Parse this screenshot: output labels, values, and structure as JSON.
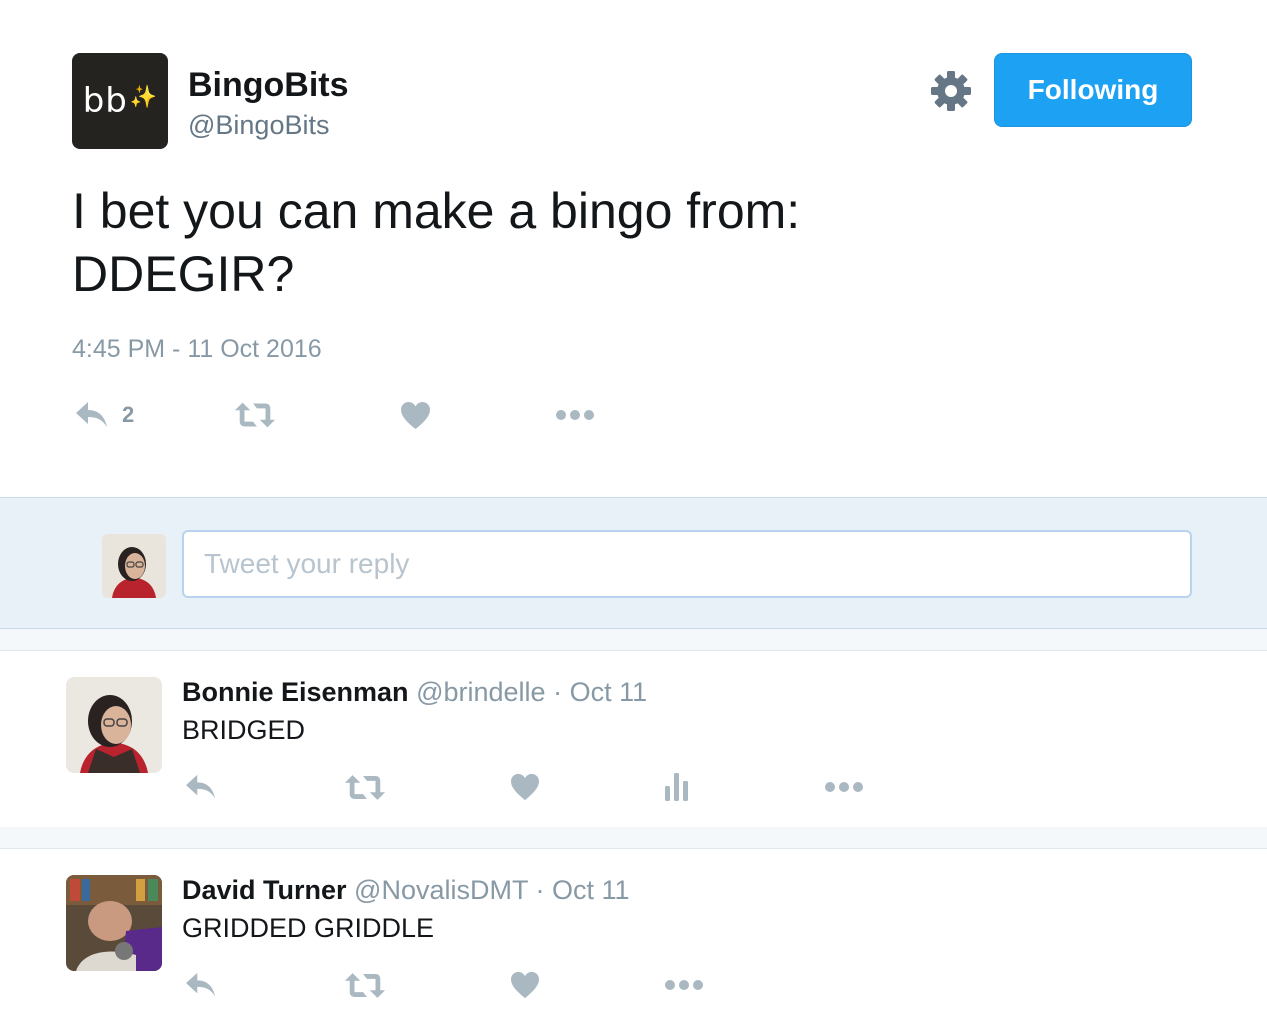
{
  "tweet": {
    "author_name": "BingoBits",
    "author_handle": "@BingoBits",
    "avatar_text": "bb",
    "avatar_glyph": "✨",
    "text": "I bet you can make a bingo from:\nDDEGIR?",
    "timestamp": "4:45 PM - 11 Oct 2016",
    "reply_count": "2",
    "follow_label": "Following",
    "icons": [
      "settings-gear-icon",
      "reply-icon",
      "retweet-icon",
      "like-heart-icon",
      "more-dots-icon"
    ]
  },
  "reply_box": {
    "placeholder": "Tweet your reply"
  },
  "replies": [
    {
      "name": "Bonnie Eisenman",
      "handle": "@brindelle",
      "separator": "·",
      "date": "Oct 11",
      "text": "BRIDGED",
      "icons": [
        "reply-icon",
        "retweet-icon",
        "like-heart-icon",
        "analytics-icon",
        "more-dots-icon"
      ]
    },
    {
      "name": "David Turner",
      "handle": "@NovalisDMT",
      "separator": "·",
      "date": "Oct 11",
      "text": "GRIDDED GRIDDLE",
      "icons": [
        "reply-icon",
        "retweet-icon",
        "like-heart-icon",
        "more-dots-icon"
      ]
    }
  ],
  "colors": {
    "accent": "#1da1f2",
    "icon_gray": "#aab8c2",
    "meta_gray": "#8899a6",
    "reply_bg": "#e8f0f8"
  }
}
